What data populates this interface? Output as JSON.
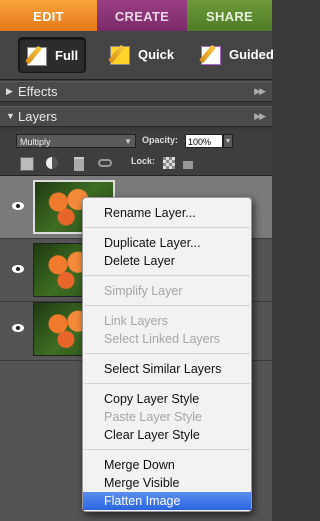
{
  "tabs": [
    {
      "label": "EDIT"
    },
    {
      "label": "CREATE"
    },
    {
      "label": "SHARE"
    }
  ],
  "modes": [
    {
      "label": "Full"
    },
    {
      "label": "Quick"
    },
    {
      "label": "Guided"
    }
  ],
  "panels": {
    "effects": "Effects",
    "layers": "Layers"
  },
  "layer_options": {
    "blend_mode": "Multiply",
    "opacity_label": "Opacity:",
    "opacity_value": "100%",
    "lock_label": "Lock:"
  },
  "context_menu": {
    "items": [
      {
        "label": "Rename Layer...",
        "enabled": true
      },
      {
        "label": "Duplicate Layer...",
        "enabled": true
      },
      {
        "label": "Delete Layer",
        "enabled": true
      },
      {
        "label": "Simplify Layer",
        "enabled": false
      },
      {
        "label": "Link Layers",
        "enabled": false
      },
      {
        "label": "Select Linked Layers",
        "enabled": false
      },
      {
        "label": "Select Similar Layers",
        "enabled": true
      },
      {
        "label": "Copy Layer Style",
        "enabled": true
      },
      {
        "label": "Paste Layer Style",
        "enabled": false
      },
      {
        "label": "Clear Layer Style",
        "enabled": true
      },
      {
        "label": "Merge Down",
        "enabled": true
      },
      {
        "label": "Merge Visible",
        "enabled": true
      },
      {
        "label": "Flatten Image",
        "enabled": true,
        "highlighted": true
      }
    ]
  },
  "colors": {
    "edit_tab": "#e8791c",
    "create_tab": "#7a2a69",
    "share_tab": "#4f7a26",
    "menu_highlight": "#2a64e0"
  }
}
